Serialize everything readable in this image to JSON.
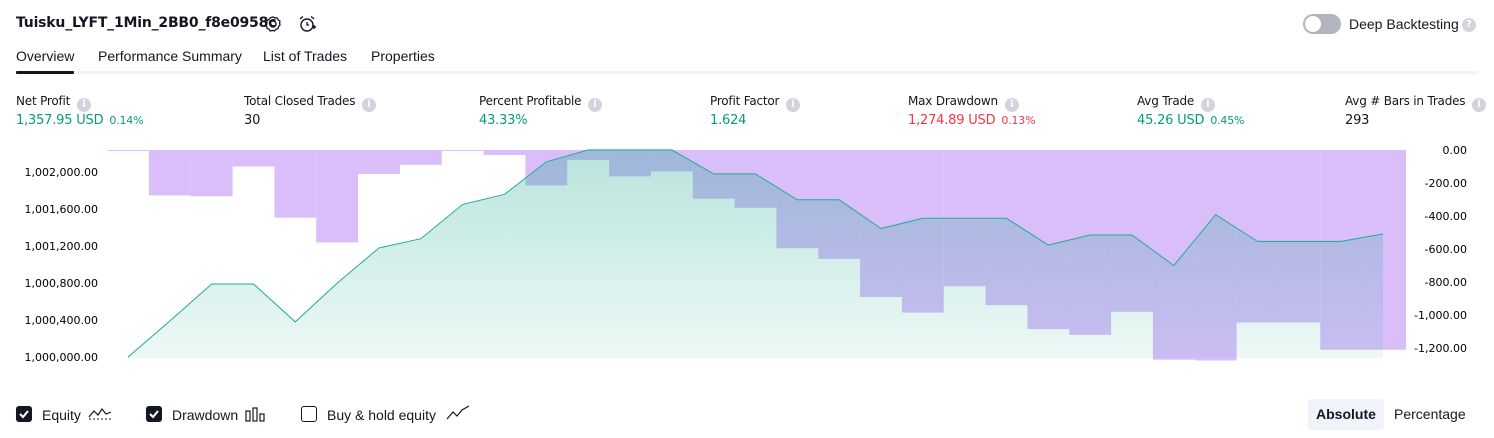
{
  "header": {
    "strategy_name": "Tuisku_LYFT_1Min_2BB0_f8e0958c",
    "settings_icon": "gear-icon",
    "alert_icon": "alarm-clock-icon",
    "deep_backtesting_label": "Deep Backtesting",
    "deep_backtesting_enabled": false
  },
  "tabs": [
    {
      "label": "Overview",
      "active": true
    },
    {
      "label": "Performance Summary",
      "active": false
    },
    {
      "label": "List of Trades",
      "active": false
    },
    {
      "label": "Properties",
      "active": false
    }
  ],
  "metrics": [
    {
      "label": "Net Profit",
      "value": "1,357.95 USD",
      "percent": "0.14%",
      "color": "#089981"
    },
    {
      "label": "Total Closed Trades",
      "value": "30",
      "percent": "",
      "color": "#131722"
    },
    {
      "label": "Percent Profitable",
      "value": "43.33%",
      "percent": "",
      "color": "#089981"
    },
    {
      "label": "Profit Factor",
      "value": "1.624",
      "percent": "",
      "color": "#089981"
    },
    {
      "label": "Max Drawdown",
      "value": "1,274.89 USD",
      "percent": "0.13%",
      "color": "#f23645"
    },
    {
      "label": "Avg Trade",
      "value": "45.26 USD",
      "percent": "0.45%",
      "color": "#089981"
    },
    {
      "label": "Avg # Bars in Trades",
      "value": "293",
      "percent": "",
      "color": "#131722"
    }
  ],
  "chart_data": {
    "type": "area",
    "equity_color": "#22ab94",
    "drawdown_color": "#d7bbfa",
    "left_axis": {
      "ticks": [
        "1,002,000.00",
        "1,001,600.00",
        "1,001,200.00",
        "1,000,800.00",
        "1,000,400.00",
        "1,000,000.00"
      ],
      "tick_values": [
        1002000,
        1001600,
        1001200,
        1000800,
        1000400,
        1000000
      ],
      "range": [
        999990,
        1002260
      ]
    },
    "right_axis": {
      "ticks": [
        "0.00",
        "-200.00",
        "-400.00",
        "-600.00",
        "-800.00",
        "-1,000.00",
        "-1,200.00"
      ],
      "tick_values": [
        0,
        -200,
        -400,
        -600,
        -800,
        -1000,
        -1200
      ],
      "range": [
        -1260,
        0
      ]
    },
    "x_ticks": [
      "1",
      "3",
      "5",
      "7",
      "9",
      "11",
      "13",
      "15",
      "17",
      "19",
      "21",
      "23",
      "25",
      "27",
      "29",
      "31"
    ],
    "x_range": [
      1,
      31
    ],
    "equity": {
      "x": [
        1,
        2,
        3,
        4,
        5,
        6,
        7,
        8,
        9,
        10,
        11,
        12,
        13,
        14,
        15,
        16,
        17,
        18,
        19,
        20,
        21,
        22,
        23,
        24,
        25,
        26,
        27,
        28,
        29,
        30,
        31
      ],
      "y": [
        1000000,
        1000390,
        1000790,
        1000790,
        1000380,
        1000800,
        1001180,
        1001280,
        1001650,
        1001760,
        1002110,
        1002240,
        1002240,
        1002240,
        1001980,
        1001980,
        1001700,
        1001700,
        1001390,
        1001500,
        1001500,
        1001500,
        1001210,
        1001320,
        1001320,
        1000990,
        1001540,
        1001250,
        1001250,
        1001250,
        1001330
      ]
    },
    "drawdown": {
      "trades": [
        1,
        2,
        3,
        4,
        5,
        6,
        7,
        8,
        9,
        10,
        11,
        12,
        13,
        14,
        15,
        16,
        17,
        18,
        19,
        20,
        21,
        22,
        23,
        24,
        25,
        26,
        27,
        28,
        29,
        30,
        31
      ],
      "values": [
        -5,
        -275,
        -280,
        -100,
        -410,
        -560,
        -145,
        -90,
        0,
        -30,
        -215,
        -60,
        -160,
        -130,
        -295,
        -350,
        -595,
        -660,
        -890,
        -985,
        -825,
        -940,
        -1085,
        -1120,
        -980,
        -1270,
        -1275,
        -1045,
        -1045,
        -1210,
        -1210
      ]
    }
  },
  "legend": {
    "equity_label": "Equity",
    "equity_checked": true,
    "drawdown_label": "Drawdown",
    "drawdown_checked": true,
    "buyhold_label": "Buy & hold equity",
    "buyhold_checked": false
  },
  "mode": {
    "absolute_label": "Absolute",
    "percentage_label": "Percentage",
    "selected": "Absolute"
  }
}
